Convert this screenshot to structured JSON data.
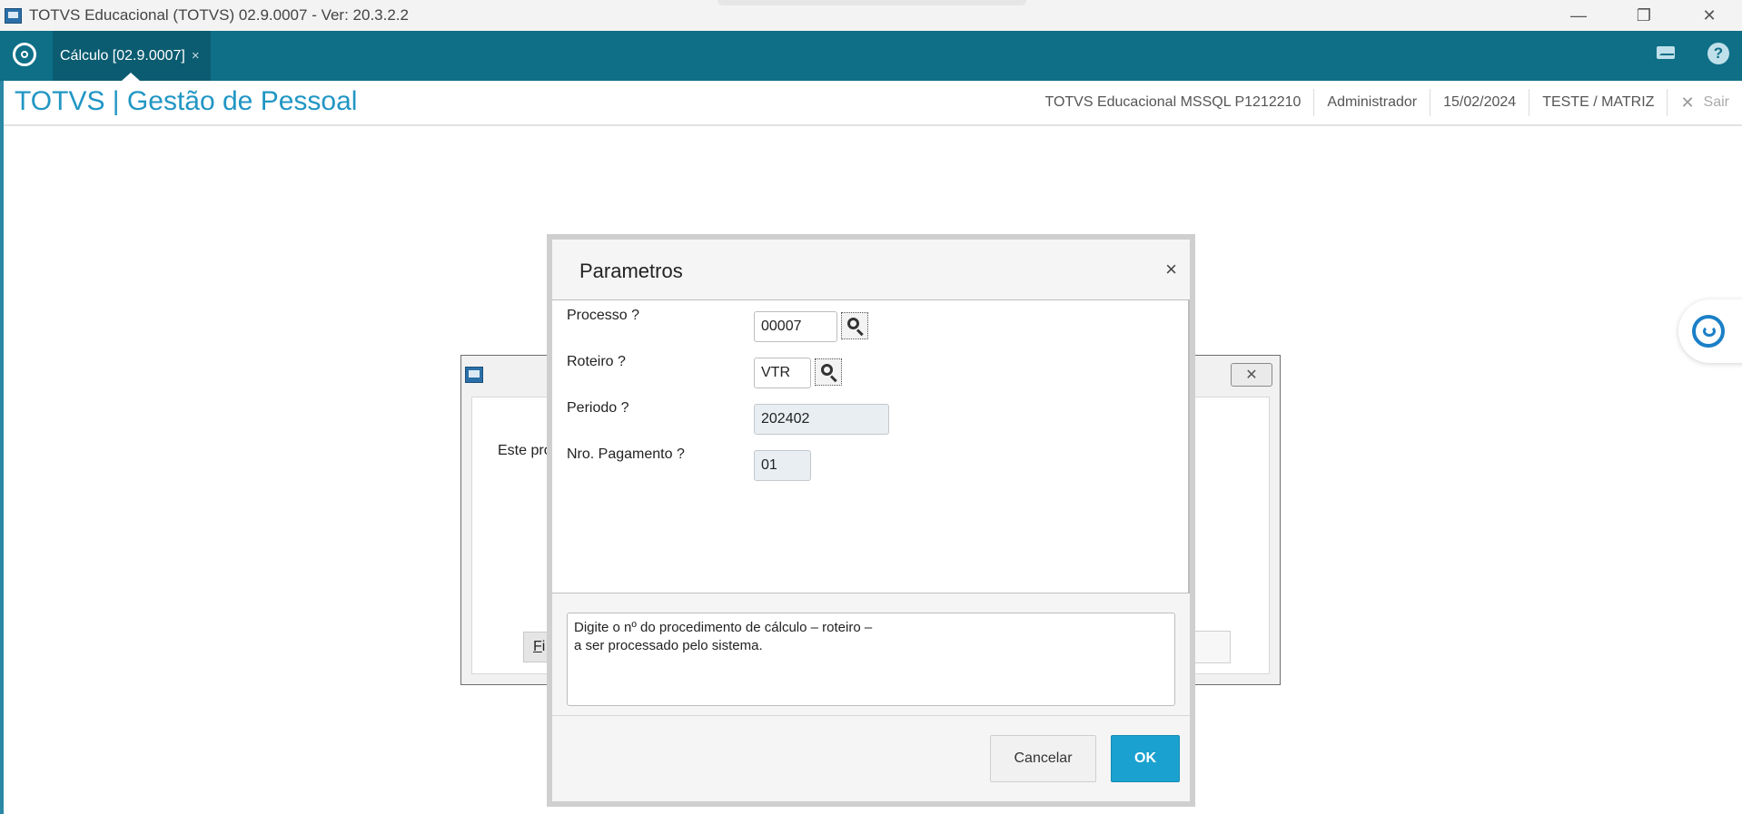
{
  "window": {
    "title": "TOTVS Educacional (TOTVS) 02.9.0007 - Ver: 20.3.2.2",
    "controls": {
      "minimize": "—",
      "restore": "❐",
      "close": "✕"
    }
  },
  "tabbar": {
    "tabs": [
      {
        "label": "Cálculo [02.9.0007]",
        "close": "×"
      }
    ],
    "icons": [
      "home-icon",
      "mail-icon",
      "help-icon"
    ],
    "help_glyph": "?"
  },
  "header": {
    "title": "TOTVS | Gestão de Pessoal",
    "environment": "TOTVS Educacional MSSQL P1212210",
    "user": "Administrador",
    "date": "15/02/2024",
    "branch": "TESTE / MATRIZ",
    "logout_label": "Sair",
    "logout_glyph": "✕"
  },
  "background_dialog": {
    "text": "Este pro",
    "button_prefix": "F",
    "button_rest": "i",
    "close_glyph": "✕"
  },
  "parameters_dialog": {
    "title": "Parametros",
    "close_glyph": "×",
    "fields": [
      {
        "label": "Processo ?",
        "value": "00007"
      },
      {
        "label": "Roteiro ?",
        "value": "VTR"
      },
      {
        "label": "Periodo ?",
        "value": "202402"
      },
      {
        "label": "Nro. Pagamento ?",
        "value": "01"
      }
    ],
    "help_text_line1": "Digite o nº do procedimento de cálculo – roteiro –",
    "help_text_line2": "a ser processado pelo sistema.",
    "cancel_label": "Cancelar",
    "ok_label": "OK"
  },
  "colors": {
    "tabbar": "#0e6f87",
    "title_blue": "#2196c4",
    "ok_button": "#1aa1cf"
  }
}
